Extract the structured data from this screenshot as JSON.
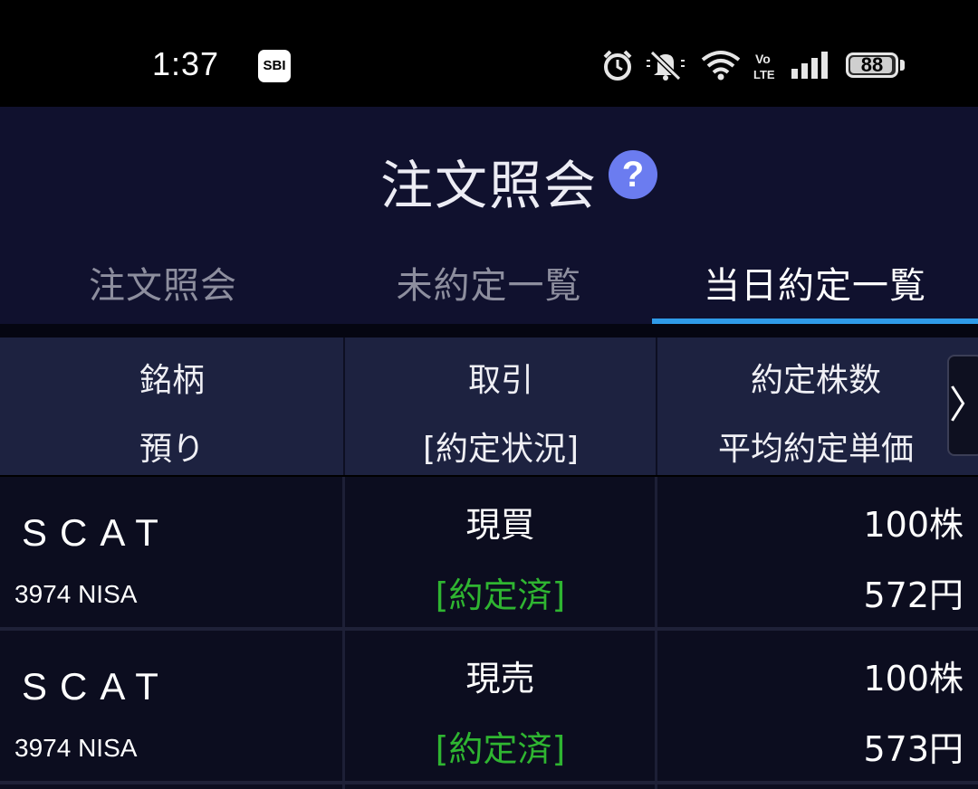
{
  "status_bar": {
    "time": "1:37",
    "app_badge": "SBI",
    "battery": "88",
    "battery_level_percent": 88,
    "icons": [
      "alarm-icon",
      "mute-icon",
      "wifi-icon",
      "volte-icon",
      "signal-icon",
      "battery-icon"
    ]
  },
  "header": {
    "title": "注文照会",
    "help_symbol": "?"
  },
  "tabs": [
    {
      "label": "注文照会",
      "active": false
    },
    {
      "label": "未約定一覧",
      "active": false
    },
    {
      "label": "当日約定一覧",
      "active": true
    }
  ],
  "table": {
    "columns": [
      {
        "line1": "銘柄",
        "line2": "預り"
      },
      {
        "line1": "取引",
        "line2": "[約定状況]"
      },
      {
        "line1": "約定株数",
        "line2": "平均約定単価"
      }
    ],
    "next_arrow": "〉",
    "rows": [
      {
        "symbol": "SCAT",
        "code": "3974 NISA",
        "trade": "現買",
        "status": "[約定済]",
        "quantity": "100株",
        "price": "572円"
      },
      {
        "symbol": "SCAT",
        "code": "3974 NISA",
        "trade": "現売",
        "status": "[約定済]",
        "quantity": "100株",
        "price": "573円"
      }
    ]
  },
  "colors": {
    "header_bg": "#10112e",
    "tab_active_underline": "#2f9be8",
    "status_green": "#2fb531",
    "help_icon": "#6b7cf0"
  }
}
